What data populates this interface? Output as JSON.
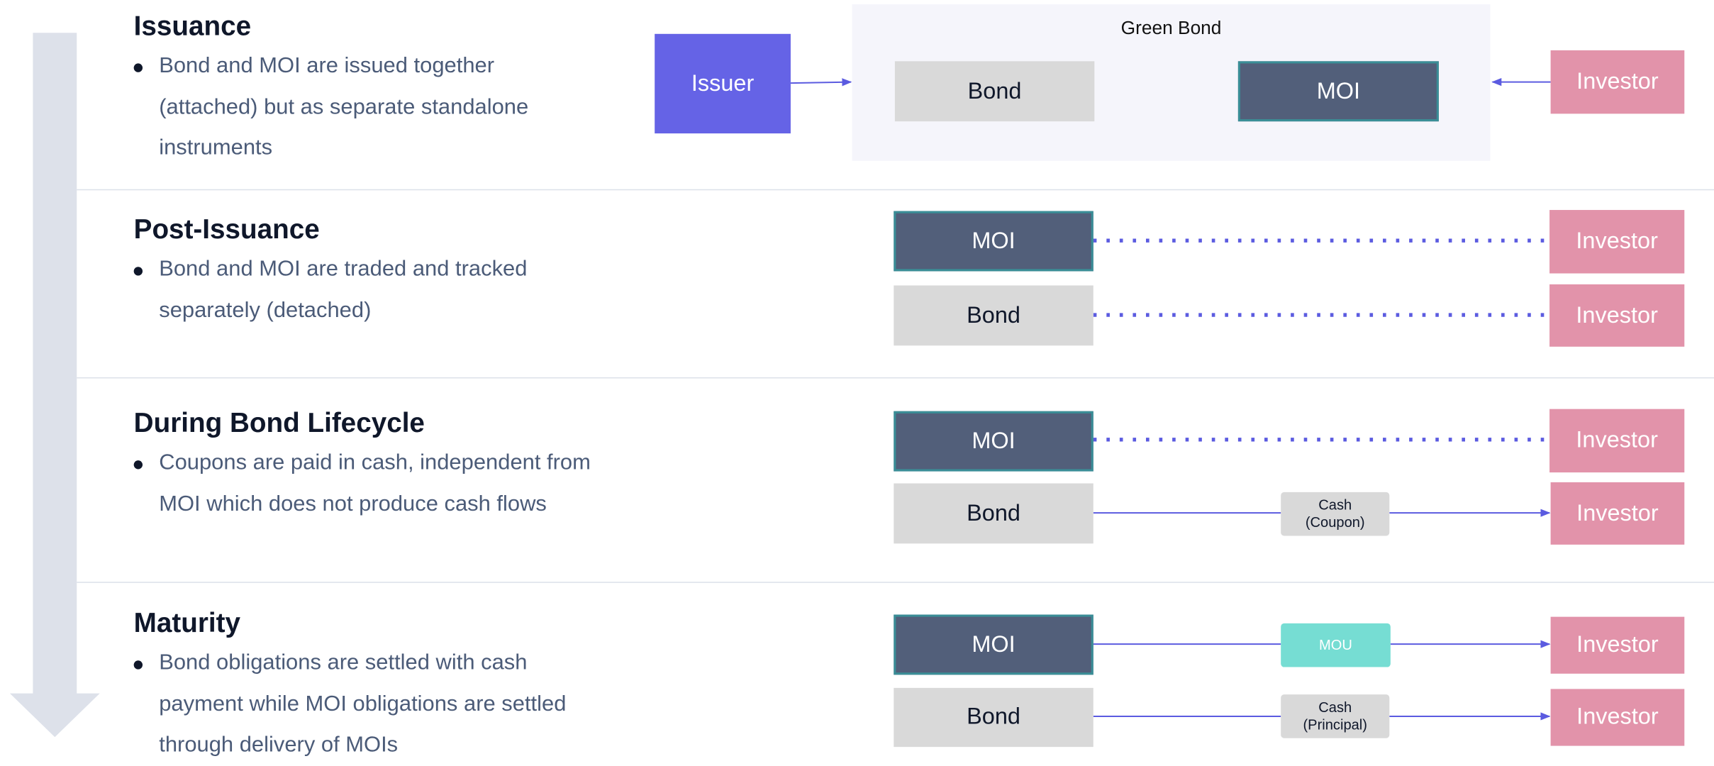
{
  "stages": [
    {
      "title": "Issuance",
      "bullet": "Bond and MOI are issued together (attached) but as separate standalone instruments"
    },
    {
      "title": "Post-Issuance",
      "bullet": "Bond and MOI are traded and tracked separately (detached)"
    },
    {
      "title": "During Bond Lifecycle",
      "bullet": "Coupons are paid in cash, independent from MOI which does not produce cash flows"
    },
    {
      "title": "Maturity",
      "bullet": "Bond obligations are settled with cash payment while MOI obligations are settled through delivery of MOIs"
    }
  ],
  "issuance": {
    "group_label": "Green Bond",
    "issuer": "Issuer",
    "bond": "Bond",
    "moi": "MOI",
    "investor": "Investor"
  },
  "post_issuance": {
    "moi": "MOI",
    "moi_investor": "Investor",
    "bond": "Bond",
    "bond_investor": "Investor"
  },
  "lifecycle": {
    "moi": "MOI",
    "moi_investor": "Investor",
    "bond": "Bond",
    "bond_investor": "Investor",
    "coupon_line1": "Cash",
    "coupon_line2": "(Coupon)"
  },
  "maturity": {
    "moi": "MOI",
    "moi_investor": "Investor",
    "mou": "MOU",
    "bond": "Bond",
    "bond_investor": "Investor",
    "principal_line1": "Cash",
    "principal_line2": "(Principal)"
  },
  "colors": {
    "issuer": "#6563e6",
    "moi": "#525f7a",
    "bond": "#d9d9d9",
    "investor": "#e293aa",
    "mou": "#76ddd3",
    "link": "#5b5be0",
    "timeline": "#dde1ea"
  }
}
